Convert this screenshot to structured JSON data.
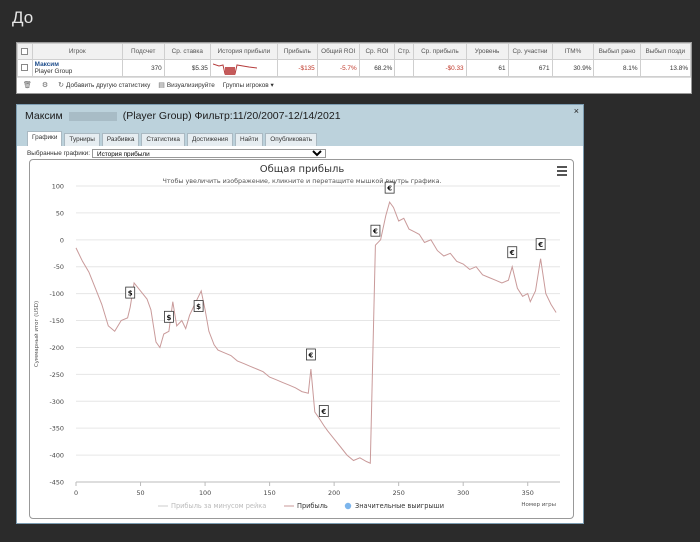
{
  "page": {
    "heading": "До"
  },
  "stats": {
    "columns": [
      "Игрок",
      "Подсчет",
      "Ср. ставка",
      "История прибыли",
      "Прибыль",
      "Общий ROI",
      "Ср. ROI",
      "Стр.",
      "Ср. прибыль",
      "Уровень",
      "Ср. участни",
      "ITM%",
      "Выбыл рано",
      "Выбыл позди"
    ],
    "row": {
      "player_name": "Максим",
      "player_group": "Player Group",
      "count": "370",
      "avg_stake": "$5.35",
      "profit": "-$135",
      "total_roi": "-5.7%",
      "avg_roi": "68.2%",
      "str": "",
      "avg_profit": "-$0.33",
      "level": "61",
      "avg_entrants": "671",
      "itm": "30.9%",
      "early": "8.1%",
      "late": "13.8%"
    },
    "toolbar": {
      "add_stat": "Добавить другую статистику",
      "visualize": "Визуализируйте",
      "groups": "Группы игроков"
    }
  },
  "dialog": {
    "title_name": "Максим",
    "title_rest": "(Player Group) Фильтр:11/20/2007-12/14/2021",
    "close": "×",
    "tabs": [
      "Графики",
      "Турниры",
      "Разбивка",
      "Статистика",
      "Достижения",
      "Найти",
      "Опубликовать"
    ],
    "selected_label": "Выбранные графики:",
    "selected_value": "История прибыли"
  },
  "chart_data": {
    "type": "line",
    "title": "Общая прибыль",
    "subtitle": "Чтобы увеличить изображение, кликните и перетащите мышкой внутрь графика.",
    "xlabel": "Номер игры",
    "ylabel": "Суммарный итог (USD)",
    "xlim": [
      0,
      375
    ],
    "ylim": [
      -450,
      100
    ],
    "xticks": [
      0,
      50,
      100,
      150,
      200,
      250,
      300,
      350
    ],
    "yticks": [
      100,
      50,
      0,
      -50,
      -100,
      -150,
      -200,
      -250,
      -300,
      -350,
      -400,
      -450
    ],
    "legend": [
      "Прибыль за минусом рейка",
      "Прибыль",
      "Значительные выигрыши"
    ],
    "legend_position": "bottom",
    "series": [
      {
        "name": "Прибыль",
        "color": "#c99a9a",
        "x": [
          0,
          5,
          10,
          15,
          20,
          25,
          30,
          35,
          40,
          42,
          45,
          50,
          55,
          58,
          62,
          65,
          68,
          72,
          75,
          78,
          82,
          85,
          88,
          92,
          95,
          97,
          100,
          103,
          107,
          110,
          115,
          120,
          125,
          130,
          135,
          140,
          145,
          150,
          155,
          160,
          165,
          170,
          175,
          180,
          182,
          185,
          188,
          192,
          195,
          200,
          205,
          210,
          215,
          220,
          225,
          228,
          232,
          236,
          240,
          243,
          246,
          250,
          254,
          258,
          262,
          266,
          270,
          275,
          280,
          285,
          290,
          295,
          300,
          305,
          310,
          315,
          320,
          325,
          330,
          335,
          338,
          342,
          346,
          350,
          352,
          356,
          360,
          364,
          368,
          372
        ],
        "y": [
          -15,
          -40,
          -60,
          -90,
          -120,
          -160,
          -170,
          -150,
          -145,
          -125,
          -80,
          -95,
          -110,
          -130,
          -190,
          -200,
          -175,
          -170,
          -115,
          -160,
          -150,
          -165,
          -140,
          -120,
          -105,
          -95,
          -130,
          -170,
          -195,
          -205,
          -210,
          -215,
          -225,
          -230,
          -235,
          -240,
          -245,
          -255,
          -260,
          -265,
          -270,
          -275,
          -282,
          -285,
          -240,
          -320,
          -330,
          -345,
          -355,
          -370,
          -385,
          -400,
          -410,
          -405,
          -412,
          -415,
          -10,
          0,
          45,
          70,
          60,
          35,
          40,
          20,
          15,
          10,
          -5,
          0,
          -20,
          -30,
          -25,
          -40,
          -45,
          -55,
          -50,
          -65,
          -70,
          -75,
          -80,
          -75,
          -50,
          -90,
          -105,
          -100,
          -115,
          -95,
          -35,
          -100,
          -120,
          -135
        ]
      }
    ],
    "big_wins": [
      {
        "x": 42,
        "y": -125,
        "symbol": "$"
      },
      {
        "x": 72,
        "y": -170,
        "symbol": "$"
      },
      {
        "x": 95,
        "y": -150,
        "symbol": "$"
      },
      {
        "x": 182,
        "y": -240,
        "symbol": "€"
      },
      {
        "x": 192,
        "y": -345,
        "symbol": "€"
      },
      {
        "x": 232,
        "y": -10,
        "symbol": "€"
      },
      {
        "x": 243,
        "y": 70,
        "symbol": "€"
      },
      {
        "x": 338,
        "y": -50,
        "symbol": "€"
      },
      {
        "x": 360,
        "y": -35,
        "symbol": "€"
      }
    ]
  }
}
